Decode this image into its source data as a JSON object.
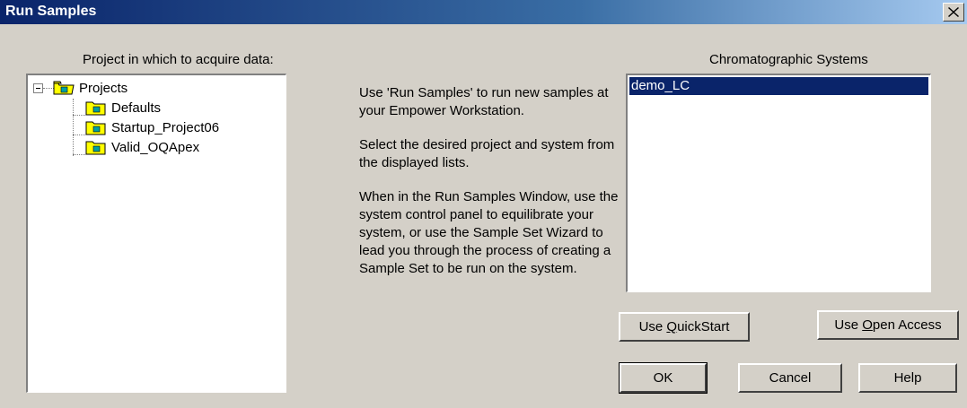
{
  "window": {
    "title": "Run Samples",
    "close_glyph": "×"
  },
  "project_panel": {
    "label": "Project in which to acquire data:",
    "tree": {
      "root": "Projects",
      "expander": "−",
      "children": [
        "Defaults",
        "Startup_Project06",
        "Valid_OQApex"
      ]
    }
  },
  "description": {
    "para1": "Use 'Run Samples' to run new samples at your Empower Workstation.",
    "para2": "Select the desired project and system from the displayed lists.",
    "para3": "When in the Run Samples Window, use the system control panel to equilibrate your system, or use the Sample Set Wizard to lead you through the process of creating a Sample Set to be run on the system."
  },
  "systems_panel": {
    "label": "Chromatographic Systems",
    "items": [
      "demo_LC"
    ],
    "selected": "demo_LC"
  },
  "buttons": {
    "quickstart_pre": "Use ",
    "quickstart_key": "Q",
    "quickstart_post": "uickStart",
    "openaccess_pre": "Use ",
    "openaccess_key": "O",
    "openaccess_post": "pen Access",
    "ok": "OK",
    "cancel": "Cancel",
    "help": "Help"
  },
  "colors": {
    "title_start": "#0a246a",
    "title_end": "#a6caf0",
    "selection": "#0a246a",
    "face": "#d4d0c8"
  },
  "icons": {
    "folder": "project-folder-icon",
    "close": "close-icon"
  }
}
